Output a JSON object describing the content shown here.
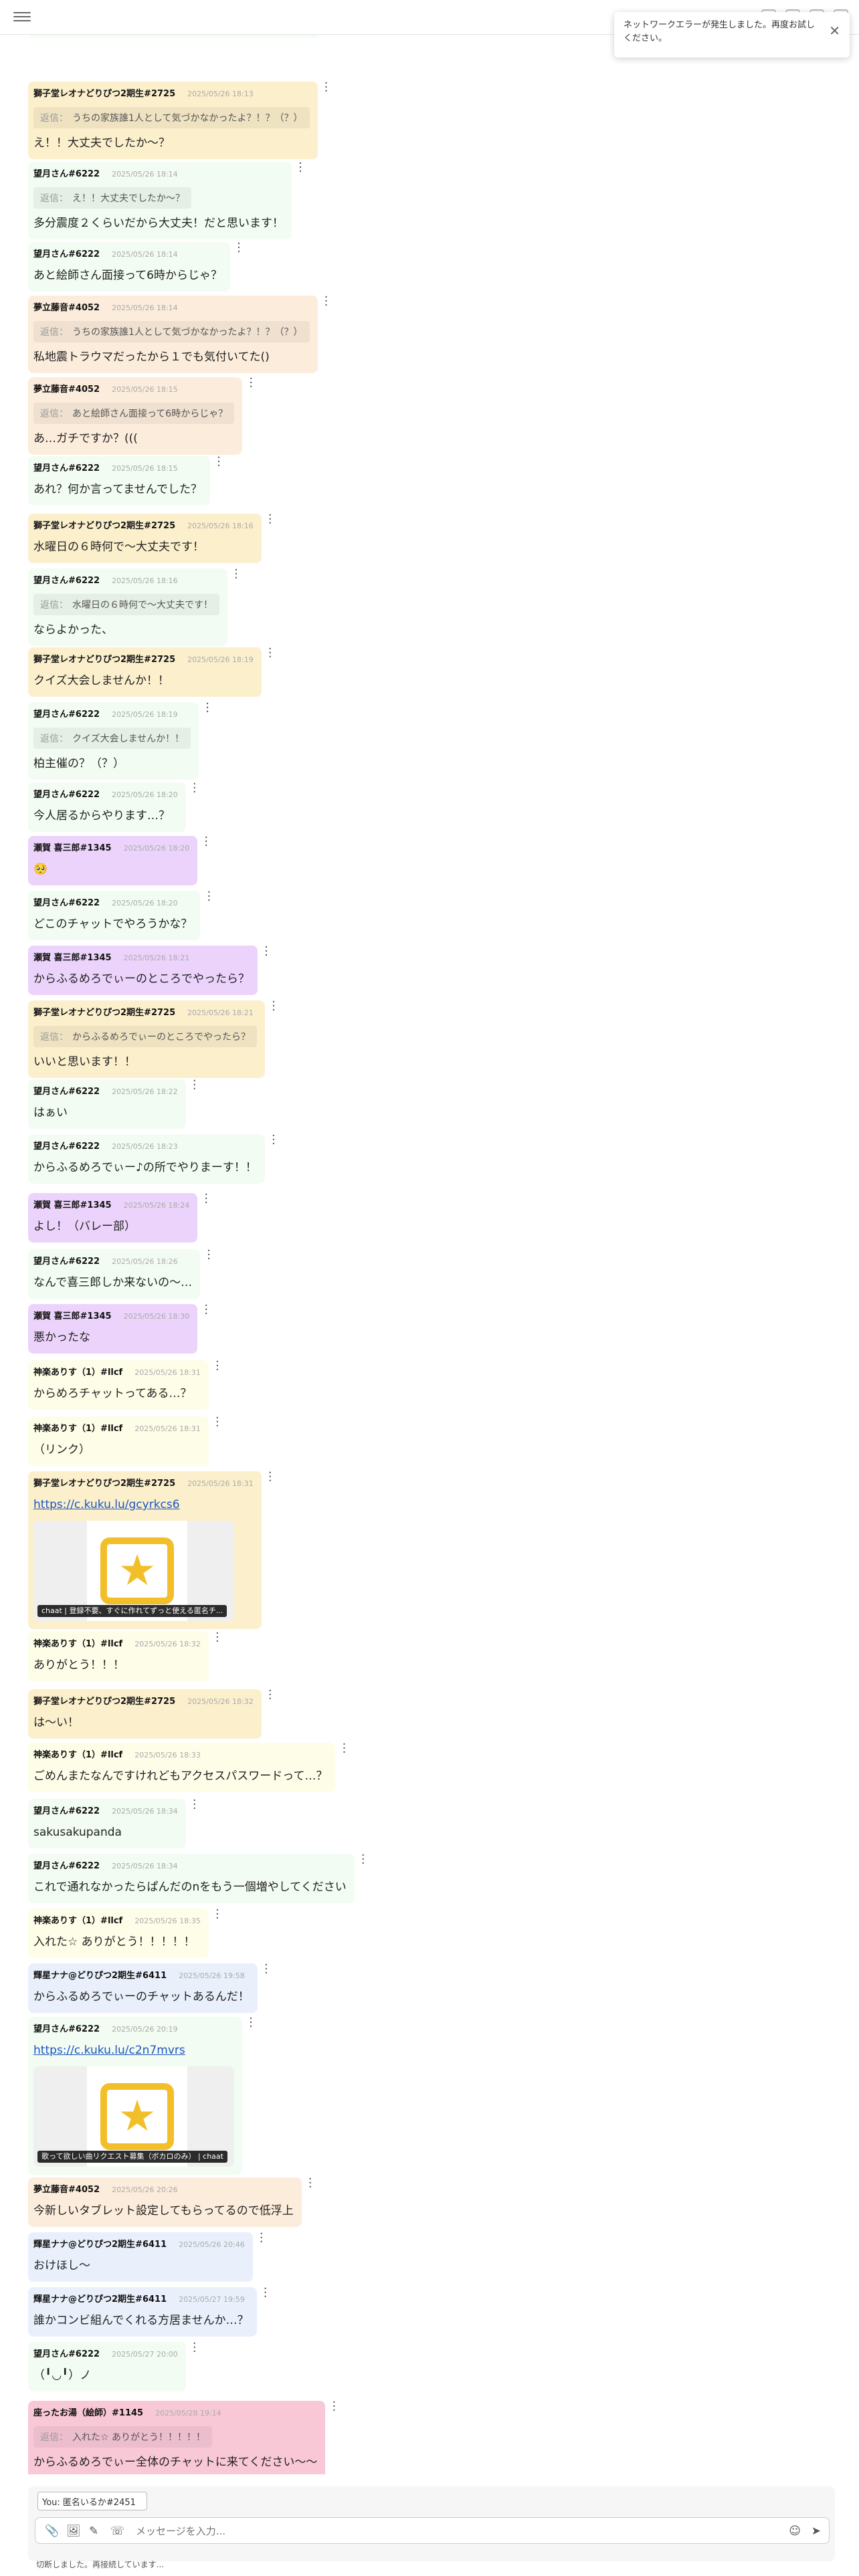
{
  "toast": {
    "text": "ネットワークエラーが発生しました。再度お試しください。",
    "close": "✕"
  },
  "messages": [
    {
      "user": "望月さん#6222",
      "time": "2025/05/26 18:13",
      "text": "うちの家族誰1人として気づかなかったよ？！？（？）",
      "color": "green"
    },
    {
      "user": "獅子堂レオナどりぴつ2期生#2725",
      "time": "2025/05/26 18:13",
      "quote": "うちの家族誰1人として気づかなかったよ？！？（？）",
      "text": "え！！大丈夫でしたか〜？",
      "color": "yellow"
    },
    {
      "user": "望月さん#6222",
      "time": "2025/05/26 18:14",
      "quote": "え！！大丈夫でしたか〜？",
      "text": "多分震度２くらいだから大丈夫！だと思います！",
      "color": "green"
    },
    {
      "user": "望月さん#6222",
      "time": "2025/05/26 18:14",
      "text": "あと絵師さん面接って6時からじゃ？",
      "color": "green"
    },
    {
      "user": "夢立藤音#4052",
      "time": "2025/05/26 18:14",
      "quote": "うちの家族誰1人として気づかなかったよ？！？（？）",
      "text": "私地震トラウマだったから１でも気付いてた()",
      "color": "orange"
    },
    {
      "user": "夢立藤音#4052",
      "time": "2025/05/26 18:15",
      "quote": "あと絵師さん面接って6時からじゃ？",
      "text": "あ…ガチですか？(((",
      "color": "orange"
    },
    {
      "user": "望月さん#6222",
      "time": "2025/05/26 18:15",
      "text": "あれ？何か言ってませんでした？",
      "color": "green"
    },
    {
      "user": "獅子堂レオナどりぴつ2期生#2725",
      "time": "2025/05/26 18:16",
      "text": "水曜日の６時何で〜大丈夫です！",
      "color": "yellow"
    },
    {
      "user": "望月さん#6222",
      "time": "2025/05/26 18:16",
      "quote": "水曜日の６時何で〜大丈夫です！",
      "text": "ならよかった、",
      "color": "green"
    },
    {
      "user": "獅子堂レオナどりぴつ2期生#2725",
      "time": "2025/05/26 18:19",
      "text": "クイズ大会しませんか！！",
      "color": "yellow"
    },
    {
      "user": "望月さん#6222",
      "time": "2025/05/26 18:19",
      "quote": "クイズ大会しませんか！！",
      "text": "柏主催の？（？）",
      "color": "green"
    },
    {
      "user": "望月さん#6222",
      "time": "2025/05/26 18:20",
      "text": "今人居るからやります…？",
      "color": "green"
    },
    {
      "user": "瀬賀 喜三郎#1345",
      "time": "2025/05/26 18:20",
      "text": "🥺",
      "color": "purple"
    },
    {
      "user": "望月さん#6222",
      "time": "2025/05/26 18:20",
      "text": "どこのチャットでやろうかな？",
      "color": "green"
    },
    {
      "user": "瀬賀 喜三郎#1345",
      "time": "2025/05/26 18:21",
      "text": "からふるめろでぃーのところでやったら？",
      "color": "purple"
    },
    {
      "user": "獅子堂レオナどりぴつ2期生#2725",
      "time": "2025/05/26 18:21",
      "quote": "からふるめろでぃーのところでやったら？",
      "text": "いいと思います！！",
      "color": "yellow"
    },
    {
      "user": "望月さん#6222",
      "time": "2025/05/26 18:22",
      "text": "はぁい",
      "color": "green"
    },
    {
      "user": "望月さん#6222",
      "time": "2025/05/26 18:23",
      "text": "からふるめろでぃー♪の所でやりまーす！！",
      "color": "green"
    },
    {
      "user": "瀬賀 喜三郎#1345",
      "time": "2025/05/26 18:24",
      "text": "よし！（バレー部）",
      "color": "purple"
    },
    {
      "user": "望月さん#6222",
      "time": "2025/05/26 18:26",
      "text": "なんで喜三郎しか来ないの〜…",
      "color": "green"
    },
    {
      "user": "瀬賀 喜三郎#1345",
      "time": "2025/05/26 18:30",
      "text": "悪かったな",
      "color": "purple"
    },
    {
      "user": "神楽ありす（1）#llcf",
      "time": "2025/05/26 18:31",
      "text": "からめろチャットってある…？",
      "color": "lemon"
    },
    {
      "user": "神楽ありす（1）#llcf",
      "time": "2025/05/26 18:31",
      "text": "（リンク）",
      "color": "lemon"
    },
    {
      "user": "獅子堂レオナどりぴつ2期生#2725",
      "time": "2025/05/26 18:31",
      "link": "https://c.kuku.lu/gcyrkcs6",
      "preview": "chaat | 登録不要、すぐに作れてずっと使える匿名チ...",
      "color": "yellow"
    },
    {
      "user": "神楽ありす（1）#llcf",
      "time": "2025/05/26 18:32",
      "text": "ありがとう！！！",
      "color": "lemon"
    },
    {
      "user": "獅子堂レオナどりぴつ2期生#2725",
      "time": "2025/05/26 18:32",
      "text": "は〜い！",
      "color": "yellow"
    },
    {
      "user": "神楽ありす（1）#llcf",
      "time": "2025/05/26 18:33",
      "text": "ごめんまたなんですけれどもアクセスパスワードって…？",
      "color": "lemon"
    },
    {
      "user": "望月さん#6222",
      "time": "2025/05/26 18:34",
      "text": "sakusakupanda",
      "color": "green"
    },
    {
      "user": "望月さん#6222",
      "time": "2025/05/26 18:34",
      "text": "これで通れなかったらぱんだのnをもう一個増やしてください",
      "color": "green"
    },
    {
      "user": "神楽ありす（1）#llcf",
      "time": "2025/05/26 18:35",
      "text": "入れた☆ ありがとう！！！！！",
      "color": "lemon"
    },
    {
      "user": "輝星ナナ@どりぴつ2期生#6411",
      "time": "2025/05/26 19:58",
      "text": "からふるめろでぃーのチャットあるんだ！",
      "color": "blue"
    },
    {
      "user": "望月さん#6222",
      "time": "2025/05/26 20:19",
      "link": "https://c.kuku.lu/c2n7mvrs",
      "preview": "歌って欲しい曲リクエスト募集（ボカロのみ） | chaat",
      "color": "green"
    },
    {
      "user": "夢立藤音#4052",
      "time": "2025/05/26 20:26",
      "text": "今新しいタブレット設定してもらってるので低浮上",
      "color": "orange"
    },
    {
      "user": "輝星ナナ@どりぴつ2期生#6411",
      "time": "2025/05/26 20:46",
      "text": "おけほし〜",
      "color": "blue"
    },
    {
      "user": "輝星ナナ@どりぴつ2期生#6411",
      "time": "2025/05/27 19:59",
      "text": "誰かコンビ組んでくれる方居ませんか…？",
      "color": "blue"
    },
    {
      "user": "望月さん#6222",
      "time": "2025/05/27 20:00",
      "text": "（╹◡╹）ノ",
      "color": "green"
    },
    {
      "user": "座ったお湯（絵師）#1145",
      "time": "2025/05/28 19:14",
      "quote": "入れた☆ ありがとう！！！！！",
      "text": "からふるめろでぃー全体のチャットに来てください〜〜",
      "color": "pink"
    }
  ],
  "labels": {
    "reply_prefix": "返信："
  },
  "composer": {
    "identity_value": "You: 匿名いるか#2451",
    "placeholder": "メッセージを入力...",
    "attach_icon": "paperclip-icon",
    "image_icon": "image-icon",
    "draw_icon": "pen-icon",
    "call_icon": "phone-icon",
    "emoji_icon": "smile-icon",
    "send_icon": "send-icon"
  },
  "status": "切断しました。再接続しています..."
}
